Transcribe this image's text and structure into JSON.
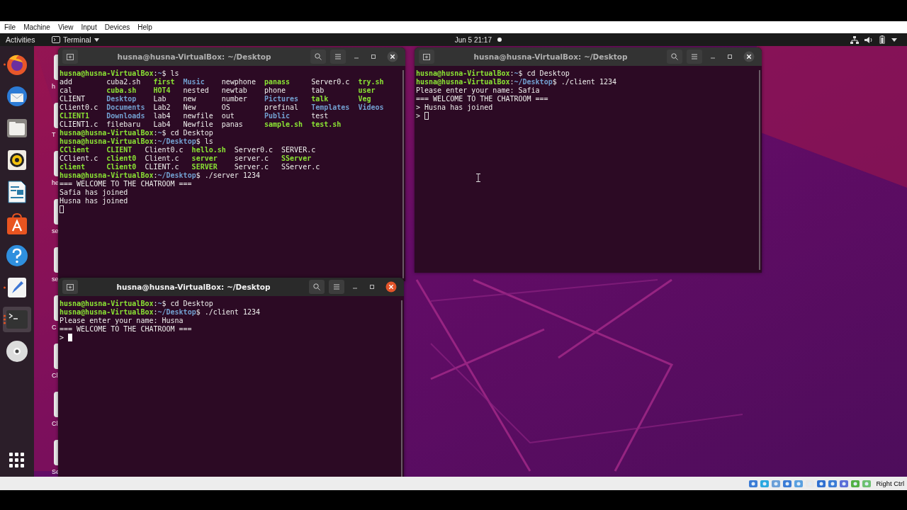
{
  "vm_menu": [
    "File",
    "Machine",
    "View",
    "Input",
    "Devices",
    "Help"
  ],
  "top_bar": {
    "activities": "Activities",
    "app_menu": "Terminal",
    "clock": "Jun 5  21:17"
  },
  "dock": [
    {
      "kind": "browser",
      "running": true,
      "active": false
    },
    {
      "kind": "mail",
      "running": false,
      "active": false
    },
    {
      "kind": "files",
      "running": false,
      "active": false
    },
    {
      "kind": "music",
      "running": false,
      "active": false
    },
    {
      "kind": "writer",
      "running": false,
      "active": false
    },
    {
      "kind": "store",
      "running": false,
      "active": false
    },
    {
      "kind": "help",
      "running": false,
      "active": false
    },
    {
      "kind": "editor",
      "running": true,
      "active": false
    },
    {
      "kind": "terminal",
      "running": true,
      "active": true
    },
    {
      "kind": "disc",
      "running": false,
      "active": false
    }
  ],
  "desktop_icons": [
    "h",
    "T",
    "he",
    "se",
    "se",
    "C",
    "Cl",
    "Cl",
    "Se"
  ],
  "terminals": [
    {
      "title": "husna@husna-VirtualBox: ~/Desktop",
      "focused": false,
      "lines": [
        {
          "kind": "prompt",
          "user": "husna@husna-VirtualBox",
          "sep": ":",
          "path": "~",
          "symbol": "$",
          "command": "ls"
        },
        {
          "kind": "ls",
          "rows": [
            [
              {
                "text": "add",
                "kind": "file"
              },
              {
                "text": "cuba2.sh",
                "kind": "file"
              },
              {
                "text": "first",
                "kind": "exec"
              },
              {
                "text": "Music",
                "kind": "dir"
              },
              {
                "text": "newphone",
                "kind": "file"
              },
              {
                "text": "panass",
                "kind": "exec"
              },
              {
                "text": "Server0.c",
                "kind": "file"
              },
              {
                "text": "try.sh",
                "kind": "exec"
              }
            ],
            [
              {
                "text": "cal",
                "kind": "file"
              },
              {
                "text": "cuba.sh",
                "kind": "exec"
              },
              {
                "text": "HOT4",
                "kind": "exec"
              },
              {
                "text": "nested",
                "kind": "file"
              },
              {
                "text": "newtab",
                "kind": "file"
              },
              {
                "text": "phone",
                "kind": "file"
              },
              {
                "text": "tab",
                "kind": "file"
              },
              {
                "text": "user",
                "kind": "exec"
              }
            ],
            [
              {
                "text": "CLIENT",
                "kind": "file"
              },
              {
                "text": "Desktop",
                "kind": "dir"
              },
              {
                "text": "Lab",
                "kind": "file"
              },
              {
                "text": "new",
                "kind": "file"
              },
              {
                "text": "number",
                "kind": "file"
              },
              {
                "text": "Pictures",
                "kind": "dir"
              },
              {
                "text": "talk",
                "kind": "exec"
              },
              {
                "text": "Veg",
                "kind": "exec"
              }
            ],
            [
              {
                "text": "Client0.c",
                "kind": "file"
              },
              {
                "text": "Documents",
                "kind": "dir"
              },
              {
                "text": "Lab2",
                "kind": "file"
              },
              {
                "text": "New",
                "kind": "file"
              },
              {
                "text": "OS",
                "kind": "file"
              },
              {
                "text": "prefinal",
                "kind": "file"
              },
              {
                "text": "Templates",
                "kind": "dir"
              },
              {
                "text": "Videos",
                "kind": "dir"
              }
            ],
            [
              {
                "text": "CLIENT1",
                "kind": "exec"
              },
              {
                "text": "Downloads",
                "kind": "dir"
              },
              {
                "text": "lab4",
                "kind": "file"
              },
              {
                "text": "newfile",
                "kind": "file"
              },
              {
                "text": "out",
                "kind": "file"
              },
              {
                "text": "Public",
                "kind": "dir"
              },
              {
                "text": "test",
                "kind": "file"
              }
            ],
            [
              {
                "text": "CLIENT1.c",
                "kind": "file"
              },
              {
                "text": "filebaru",
                "kind": "file"
              },
              {
                "text": "Lab4",
                "kind": "file"
              },
              {
                "text": "Newfile",
                "kind": "file"
              },
              {
                "text": "panas",
                "kind": "file"
              },
              {
                "text": "sample.sh",
                "kind": "exec"
              },
              {
                "text": "test.sh",
                "kind": "exec"
              }
            ]
          ]
        },
        {
          "kind": "prompt",
          "user": "husna@husna-VirtualBox",
          "sep": ":",
          "path": "~",
          "symbol": "$",
          "command": "cd Desktop"
        },
        {
          "kind": "prompt",
          "user": "husna@husna-VirtualBox",
          "sep": ":",
          "path": "~/Desktop",
          "symbol": "$",
          "command": "ls"
        },
        {
          "kind": "ls",
          "rows": [
            [
              {
                "text": "CClient",
                "kind": "exec"
              },
              {
                "text": "CLIENT",
                "kind": "exec"
              },
              {
                "text": "Client0.c",
                "kind": "file"
              },
              {
                "text": "hello.sh",
                "kind": "exec"
              },
              {
                "text": "Server0.c",
                "kind": "file"
              },
              {
                "text": "SERVER.c",
                "kind": "file"
              }
            ],
            [
              {
                "text": "CClient.c",
                "kind": "file"
              },
              {
                "text": "client0",
                "kind": "exec"
              },
              {
                "text": "Client.c",
                "kind": "file"
              },
              {
                "text": "server",
                "kind": "exec"
              },
              {
                "text": "server.c",
                "kind": "file"
              },
              {
                "text": "SServer",
                "kind": "exec"
              }
            ],
            [
              {
                "text": "client",
                "kind": "exec"
              },
              {
                "text": "Client0",
                "kind": "exec"
              },
              {
                "text": "CLIENT.c",
                "kind": "file"
              },
              {
                "text": "SERVER",
                "kind": "exec"
              },
              {
                "text": "Server.c",
                "kind": "file"
              },
              {
                "text": "SServer.c",
                "kind": "file"
              }
            ]
          ]
        },
        {
          "kind": "prompt",
          "user": "husna@husna-VirtualBox",
          "sep": ":",
          "path": "~/Desktop",
          "symbol": "$",
          "command": "./server 1234"
        },
        {
          "kind": "text",
          "text": "=== WELCOME TO THE CHATROOM ==="
        },
        {
          "kind": "text",
          "text": "Safia has joined"
        },
        {
          "kind": "text",
          "text": "Husna has joined"
        },
        {
          "kind": "input"
        }
      ]
    },
    {
      "title": "husna@husna-VirtualBox: ~/Desktop",
      "focused": false,
      "lines": [
        {
          "kind": "prompt",
          "user": "husna@husna-VirtualBox",
          "sep": ":",
          "path": "~",
          "symbol": "$",
          "command": "cd Desktop"
        },
        {
          "kind": "prompt",
          "user": "husna@husna-VirtualBox",
          "sep": ":",
          "path": "~/Desktop",
          "symbol": "$",
          "command": "./client 1234"
        },
        {
          "kind": "text",
          "text": "Please enter your name: Safia"
        },
        {
          "kind": "text",
          "text": "=== WELCOME TO THE CHATROOM ==="
        },
        {
          "kind": "text",
          "text": "> Husna has joined"
        },
        {
          "kind": "input",
          "prefix": ">"
        }
      ]
    },
    {
      "title": "husna@husna-VirtualBox: ~/Desktop",
      "focused": true,
      "lines": [
        {
          "kind": "prompt",
          "user": "husna@husna-VirtualBox",
          "sep": ":",
          "path": "~",
          "symbol": "$",
          "command": "cd Desktop"
        },
        {
          "kind": "prompt",
          "user": "husna@husna-VirtualBox",
          "sep": ":",
          "path": "~/Desktop",
          "symbol": "$",
          "command": "./client 1234"
        },
        {
          "kind": "text",
          "text": "Please enter your name: Husna"
        },
        {
          "kind": "text",
          "text": "=== WELCOME TO THE CHATROOM ==="
        },
        {
          "kind": "input",
          "prefix": ">"
        }
      ]
    }
  ],
  "status_bar": {
    "host_key": "Right Ctrl"
  }
}
